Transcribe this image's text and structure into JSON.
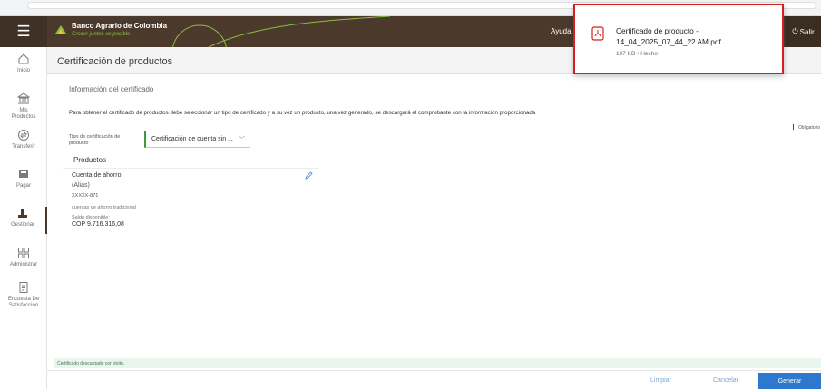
{
  "app": {
    "brand_name": "Banco Agrario de Colombia",
    "brand_tagline": "Crecer juntos es posible",
    "help_label": "Ayuda",
    "exit_label": "Salir",
    "colors": {
      "header": "#4b3a2b",
      "accent_green": "#8cbc3f",
      "primary_blue": "#2f78cf",
      "highlight_red": "#d42020"
    }
  },
  "sidebar": {
    "items": [
      {
        "label": "Inicio",
        "icon": "home-icon"
      },
      {
        "label": "Mis Productos",
        "icon": "bank-icon"
      },
      {
        "label": "Transferir",
        "icon": "transfer-icon"
      },
      {
        "label": "Pagar",
        "icon": "pay-icon"
      },
      {
        "label": "Gestionar",
        "icon": "manage-icon"
      },
      {
        "label": "Administrar",
        "icon": "grid-icon"
      },
      {
        "label": "Encuesta De Satisfacción",
        "icon": "survey-icon"
      }
    ],
    "active": "Gestionar"
  },
  "page": {
    "title": "Certificación de productos",
    "section_title": "Información del certificado",
    "instruction": "Para obtener el certificado de productos debe seleccionar un tipo de certificado y a su vez un producto, una vez generado, se descargará el comprobante con la información proporcionada",
    "required_label": "Obligatorio",
    "certificate_type_label": "Tipo de certificación de producto",
    "certificate_type_value": "Certificación de cuenta sin ...",
    "products_title": "Productos"
  },
  "product": {
    "name": "Cuenta de ahorro",
    "alias": "(Alias)",
    "number": "XXXXX-871",
    "type": "cuentas de ahorro tradicional",
    "balance_label": "Saldo disponible:",
    "balance": "COP 9.716.316,08"
  },
  "toast": {
    "message": "Certificado descargado con éxito."
  },
  "footer": {
    "clear_label": "Limpiar",
    "cancel_label": "Cancelar",
    "generate_label": "Generar"
  },
  "download": {
    "filename": "Certificado de producto - 14_04_2025_07_44_22 AM.pdf",
    "status": "197 KB • Hecho"
  }
}
